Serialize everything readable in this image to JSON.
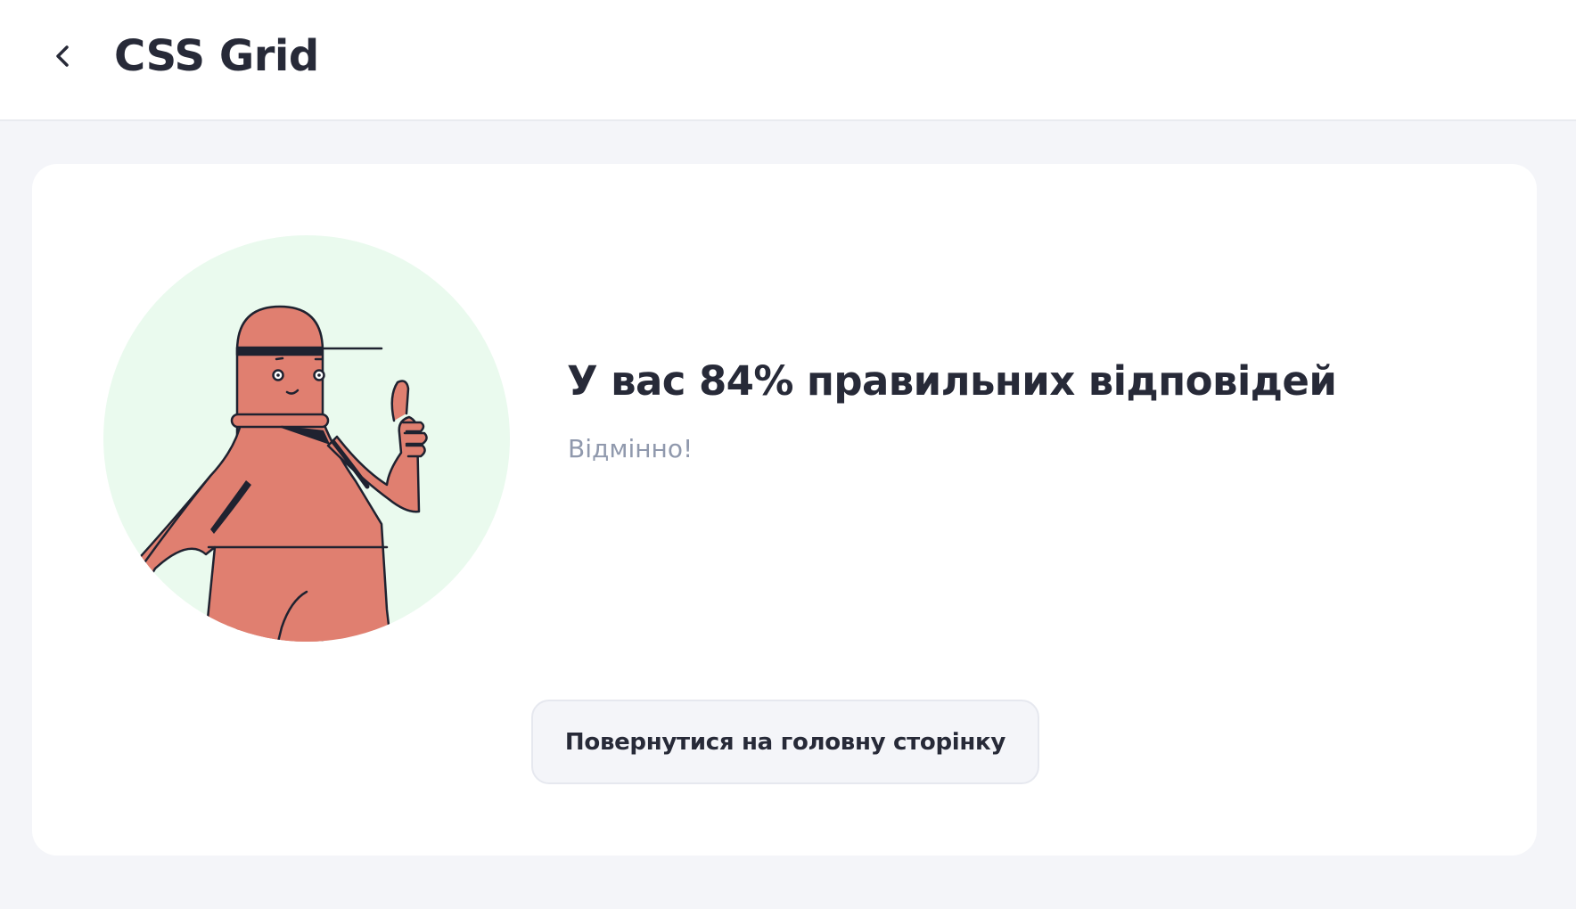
{
  "header": {
    "back_icon": "chevron-left-icon",
    "title": "CSS Grid"
  },
  "result": {
    "title": "У вас 84% правильних відповідей",
    "subtitle": "Відмінно!",
    "score_percent": 84
  },
  "actions": {
    "home_button_label": "Повернутися на головну сторінку"
  },
  "colors": {
    "background": "#f4f5f9",
    "card": "#ffffff",
    "text_primary": "#272a38",
    "text_secondary": "#9099ad",
    "illustration_circle": "#eafaee",
    "character_body": "#e07f70",
    "outline": "#1f2230"
  }
}
